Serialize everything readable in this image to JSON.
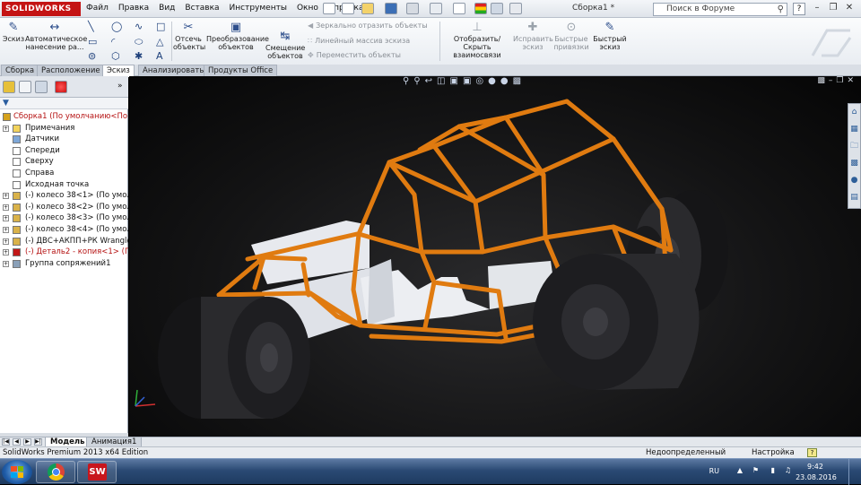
{
  "app": {
    "logo_text": "SOLIDWORKS",
    "document_title": "Сборка1 *"
  },
  "menu": [
    "Файл",
    "Правка",
    "Вид",
    "Вставка",
    "Инструменты",
    "Окно",
    "Справка"
  ],
  "search": {
    "placeholder": "Поиск в Форуме"
  },
  "ribbon": {
    "sketch": "Эскиз",
    "smart_dim_1": "Автоматическое",
    "smart_dim_2": "нанесение ра...",
    "trim_1": "Отсечь",
    "trim_2": "объекты",
    "convert_1": "Преобразование",
    "convert_2": "объектов",
    "offset_1": "Смещение",
    "offset_2": "объектов",
    "mirror": "Зеркально отразить объекты",
    "linear_pattern": "Линейный массив эскиза",
    "move": "Переместить объекты",
    "show_rel_1": "Отобразить/Скрыть",
    "show_rel_2": "взаимосвязи",
    "repair_1": "Исправить",
    "repair_2": "эскиз",
    "quick_snaps_1": "Быстрые",
    "quick_snaps_2": "привязки",
    "rapid_1": "Быстрый",
    "rapid_2": "эскиз"
  },
  "tabs": [
    "Сборка",
    "Расположение",
    "Эскиз",
    "Анализировать",
    "Продукты Office"
  ],
  "active_tab": "Эскиз",
  "tree": [
    {
      "label": "Сборка1  (По умолчанию<По",
      "expander": "",
      "icon": "assembly-icon",
      "red": true
    },
    {
      "label": "Примечания",
      "expander": "+",
      "icon": "annotations-icon",
      "red": false
    },
    {
      "label": "Датчики",
      "expander": "",
      "icon": "sensors-icon",
      "red": false
    },
    {
      "label": "Спереди",
      "expander": "",
      "icon": "plane-icon",
      "red": false
    },
    {
      "label": "Сверху",
      "expander": "",
      "icon": "plane-icon",
      "red": false
    },
    {
      "label": "Справа",
      "expander": "",
      "icon": "plane-icon",
      "red": false
    },
    {
      "label": "Исходная точка",
      "expander": "",
      "icon": "origin-icon",
      "red": false
    },
    {
      "label": "(-) колесо 38<1> (По умолча",
      "expander": "+",
      "icon": "part-icon",
      "red": false
    },
    {
      "label": "(-) колесо 38<2> (По умолча",
      "expander": "+",
      "icon": "part-icon",
      "red": false
    },
    {
      "label": "(-) колесо 38<3> (По умолча",
      "expander": "+",
      "icon": "part-icon",
      "red": false
    },
    {
      "label": "(-) колесо 38<4> (По умолча",
      "expander": "+",
      "icon": "part-icon",
      "red": false
    },
    {
      "label": "(-) ДВС+АКПП+РК Wrangler<",
      "expander": "+",
      "icon": "part-icon",
      "red": false
    },
    {
      "label": "(-) Деталь2 - копия<1> (П",
      "expander": "+",
      "icon": "part-error-icon",
      "red": true
    },
    {
      "label": "Группа сопряжений1",
      "expander": "+",
      "icon": "mates-icon",
      "red": false
    }
  ],
  "bottom_tabs": [
    "Модель",
    "Анимация1"
  ],
  "active_bottom_tab": "Модель",
  "status": {
    "edition": "SolidWorks Premium 2013 x64 Edition",
    "state": "Недоопределенный",
    "custom": "Настройка"
  },
  "taskbar": {
    "lang": "RU",
    "time": "9:42",
    "date": "23.08.2016"
  },
  "colors": {
    "frame": "#e07b10",
    "tire": "#2c2c2e",
    "panel_body": "#e8eaee",
    "brand": "#c41414"
  }
}
